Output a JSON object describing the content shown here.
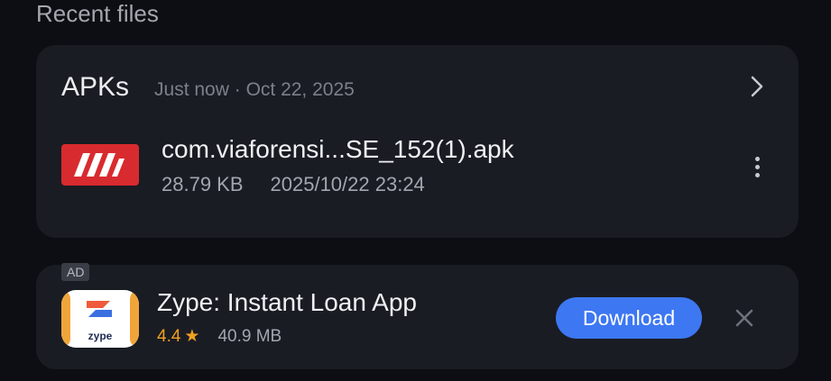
{
  "section": {
    "title": "Recent files"
  },
  "recent_card": {
    "category": "APKs",
    "timestamp": "Just now · Oct 22, 2025",
    "chevron_icon": "chevron-right-icon",
    "file": {
      "icon": "apk-file-icon",
      "name": "com.viaforensi...SE_152(1).apk",
      "size": "28.79 KB",
      "date": "2025/10/22 23:24",
      "more_icon": "more-vert-icon"
    }
  },
  "ad_card": {
    "badge": "AD",
    "app": {
      "icon": "zype-app-icon",
      "icon_text": "zype",
      "name": "Zype: Instant Loan App",
      "rating": "4.4",
      "rating_icon": "star-icon",
      "size": "40.9 MB"
    },
    "download_label": "Download",
    "close_icon": "close-icon"
  },
  "colors": {
    "background": "#0c0e13",
    "card": "#1a1c23",
    "accent_blue": "#3d77f2",
    "rating_orange": "#f1a020",
    "apk_red": "#d82b2f"
  }
}
